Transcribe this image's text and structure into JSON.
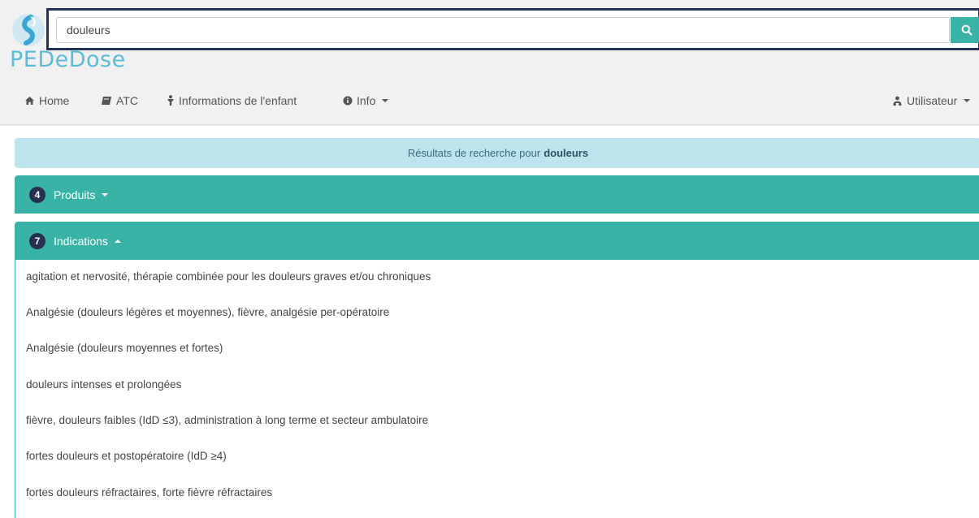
{
  "app": {
    "logo_text": "PEDeDose"
  },
  "search": {
    "value": "douleurs",
    "button_icon": "search-icon"
  },
  "nav": {
    "items": [
      {
        "label": "Home",
        "icon": "home-icon"
      },
      {
        "label": "ATC",
        "icon": "book-icon"
      },
      {
        "label": "Informations de l'enfant",
        "icon": "child-icon"
      },
      {
        "label": "Info",
        "icon": "info-icon"
      }
    ],
    "user": {
      "label": "Utilisateur",
      "icon": "users-icon"
    }
  },
  "banner": {
    "prefix": "Résultats de recherche pour",
    "query": "douleurs"
  },
  "panels": {
    "produits": {
      "count": "4",
      "label": "Produits",
      "state": "collapsed"
    },
    "indications": {
      "count": "7",
      "label": "Indications",
      "state": "expanded"
    }
  },
  "indications": [
    "agitation et nervosité, thérapie combinée pour les douleurs graves et/ou chroniques",
    "Analgésie (douleurs légères et moyennes), fièvre, analgésie per-opératoire",
    "Analgésie (douleurs moyennes et fortes)",
    "douleurs intenses et prolongées",
    "fièvre, douleurs faibles (IdD ≤3), administration à long terme et secteur ambulatoire",
    "fortes douleurs et postopératoire (IdD ≥4)",
    "fortes douleurs réfractaires, forte fièvre réfractaires"
  ],
  "colors": {
    "accent": "#39b3a6",
    "badge": "#26304f",
    "banner": "#bde3ec",
    "logo": "#5bbcd7"
  }
}
